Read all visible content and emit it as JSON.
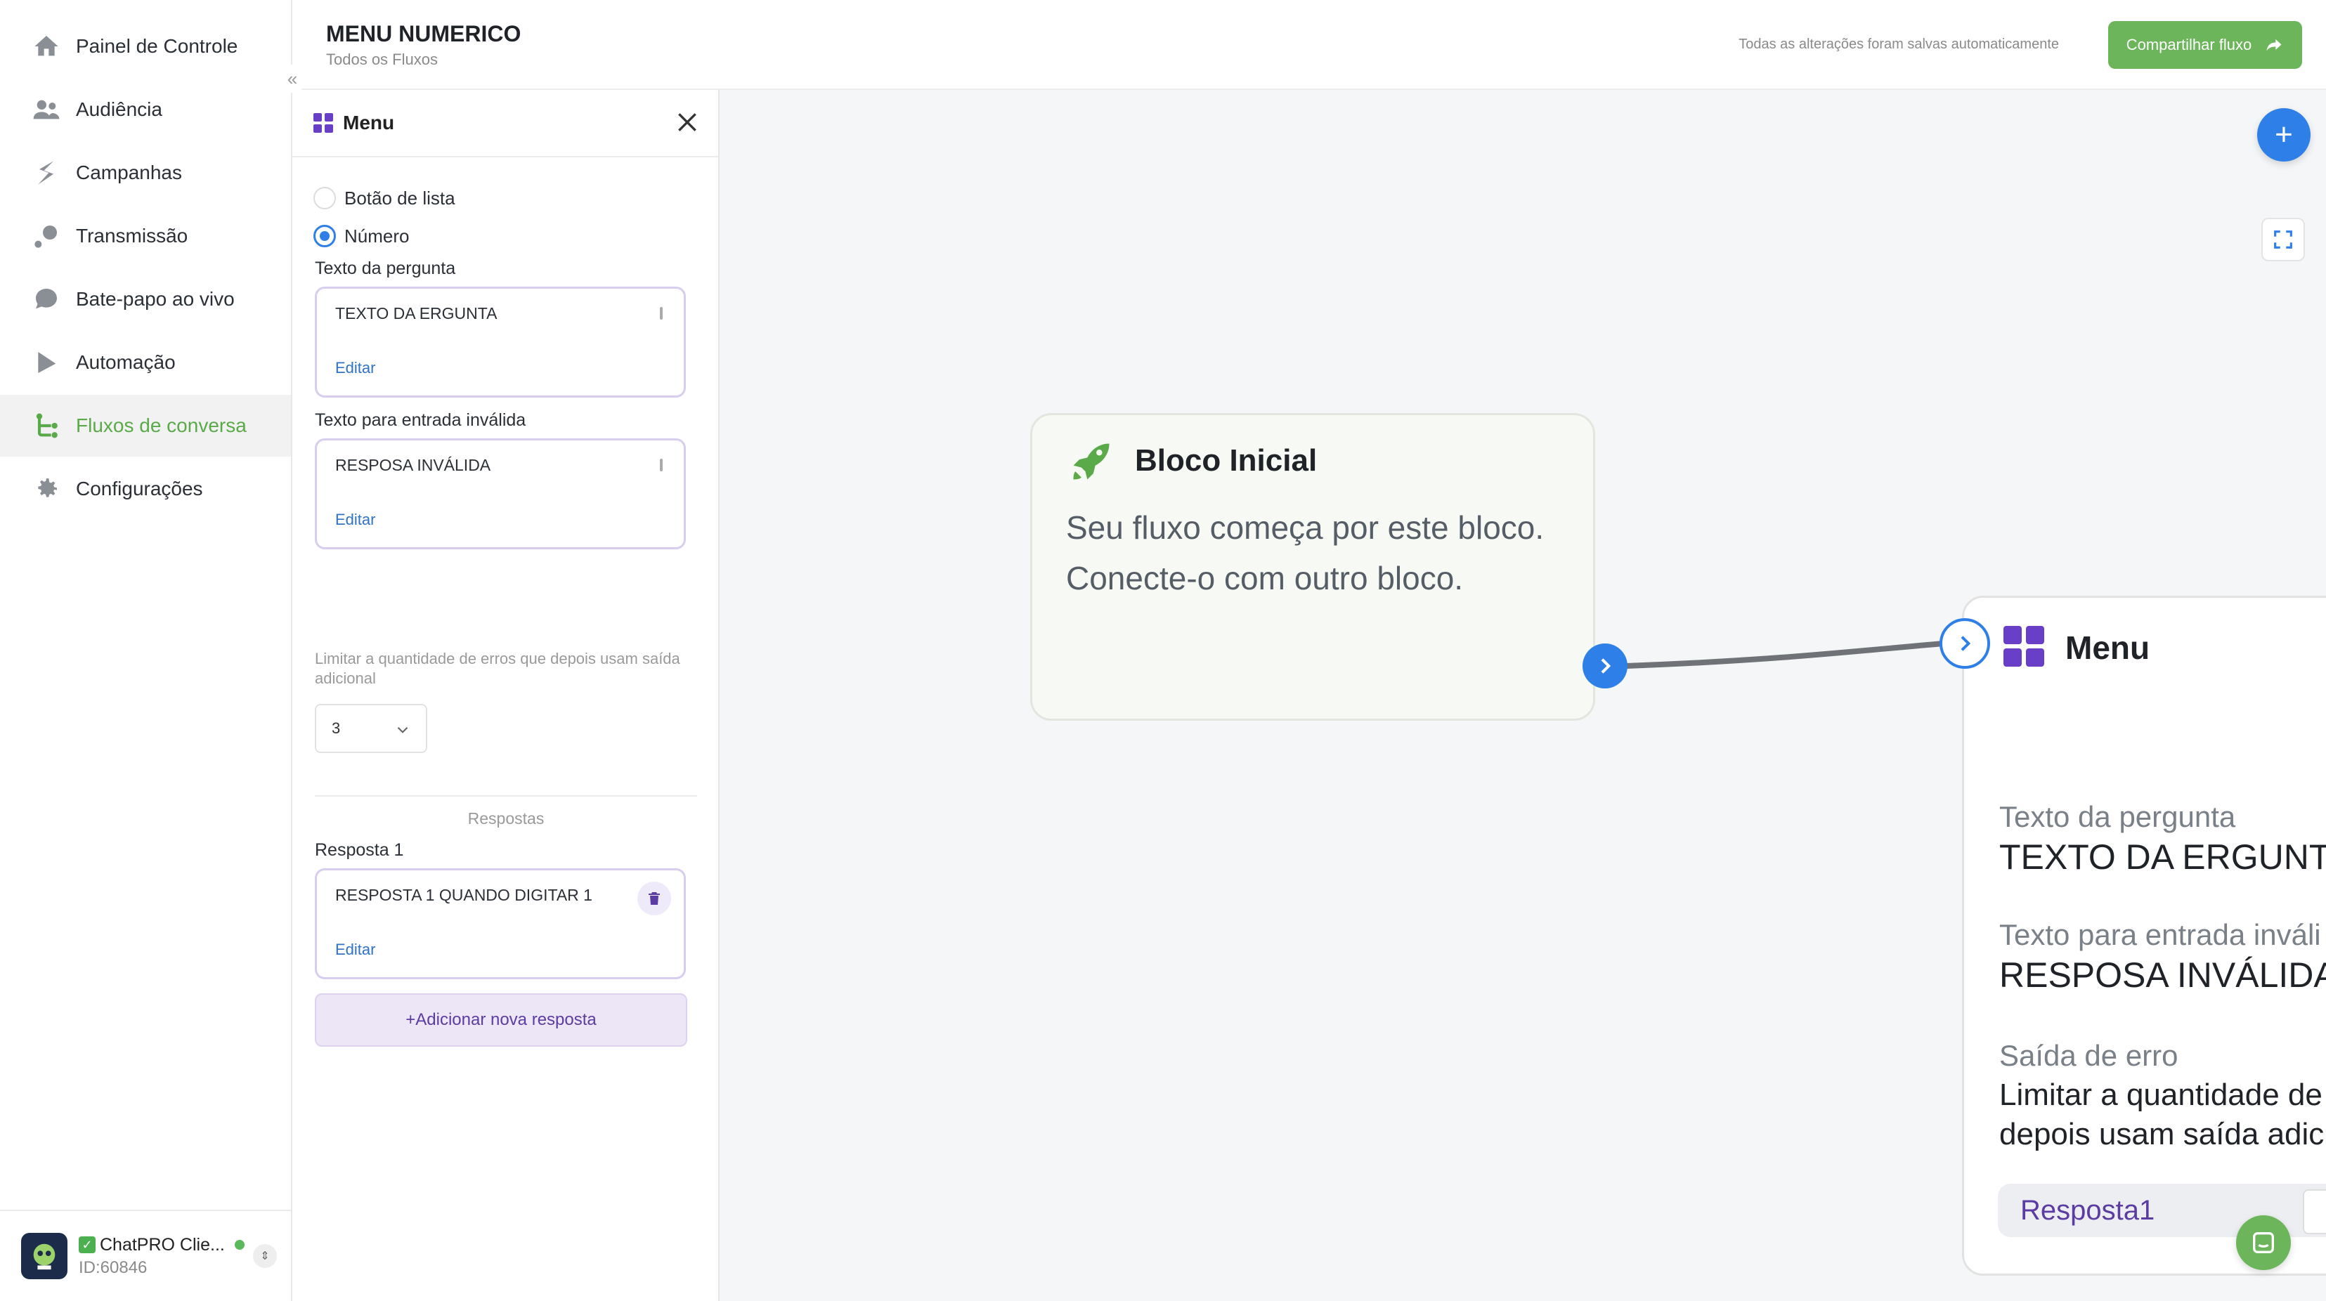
{
  "sidebar": {
    "items": [
      {
        "label": "Painel de Controle",
        "icon": "home-icon"
      },
      {
        "label": "Audiência",
        "icon": "users-icon"
      },
      {
        "label": "Campanhas",
        "icon": "campaign-icon"
      },
      {
        "label": "Transmissão",
        "icon": "broadcast-icon"
      },
      {
        "label": "Bate-papo ao vivo",
        "icon": "chat-icon"
      },
      {
        "label": "Automação",
        "icon": "automation-icon"
      },
      {
        "label": "Fluxos de conversa",
        "icon": "flow-icon"
      },
      {
        "label": "Configurações",
        "icon": "gear-icon"
      }
    ],
    "active_item": "Fluxos de conversa",
    "account": {
      "name": "ChatPRO Clie...",
      "id": "ID:60846",
      "status": "online"
    }
  },
  "header": {
    "title": "MENU NUMERICO",
    "breadcrumb": "Todos os Fluxos",
    "autosave_text": "Todas as alterações foram salvas automaticamente",
    "share_label": "Compartilhar fluxo"
  },
  "panel": {
    "title": "Menu",
    "radio_options": [
      {
        "label": "Botão de lista",
        "checked": false
      },
      {
        "label": "Número",
        "checked": true
      }
    ],
    "question_label": "Texto da pergunta",
    "question_value": "TEXTO DA ERGUNTA",
    "invalid_label": "Texto para entrada inválida",
    "invalid_value": "RESPOSA INVÁLIDA",
    "edit_label": "Editar",
    "error_limit_hint": "Limitar a quantidade de erros que depois usam saída adicional",
    "error_limit_value": "3",
    "responses_title": "Respostas",
    "responses": [
      {
        "label": "Resposta 1",
        "value": "RESPOSTA 1 QUANDO DIGITAR 1"
      }
    ],
    "add_response_label": "+Adicionar nova resposta"
  },
  "canvas": {
    "start_block": {
      "title": "Bloco Inicial",
      "description": "Seu fluxo começa por este bloco. Conecte-o com outro bloco."
    },
    "menu_block": {
      "title": "Menu",
      "question_label": "Texto da pergunta",
      "question_value": "TEXTO DA ERGUNTA",
      "invalid_label": "Texto para entrada inváli",
      "invalid_value": "RESPOSA INVÁLIDA",
      "error_exit_label": "Saída de erro",
      "error_exit_line1": "Limitar a quantidade de",
      "error_exit_line2": "depois usam saída adic",
      "response_pill": "Resposta1"
    }
  },
  "colors": {
    "brand_green": "#6cb55a",
    "accent_blue": "#2f7fe8",
    "menu_purple": "#6a3fc8"
  }
}
